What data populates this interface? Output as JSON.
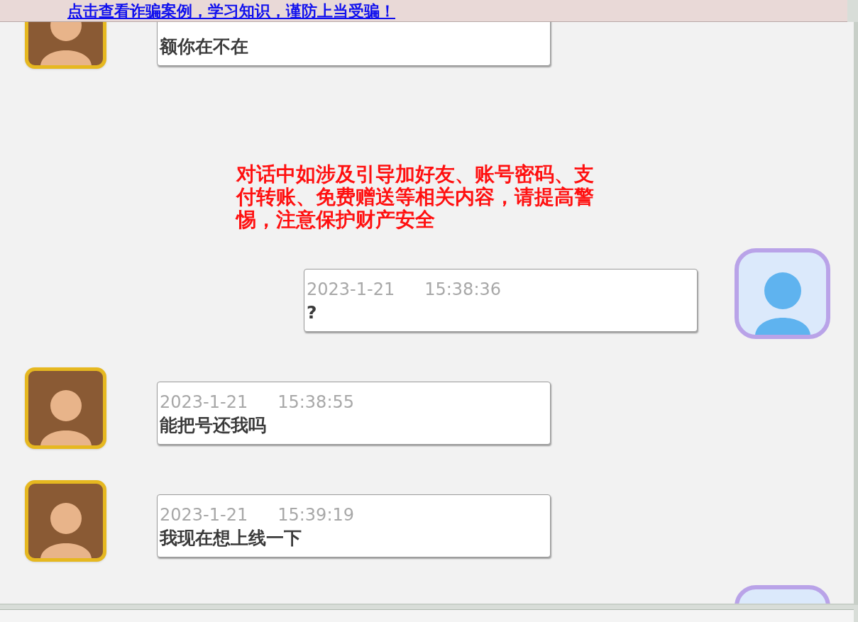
{
  "banner": {
    "link": "点击查看诈骗案例，学习知识，谨防上当受骗！"
  },
  "messages": [
    {
      "kind": "incoming",
      "text": "额你在不在"
    },
    {
      "kind": "notice",
      "text": "对话中如涉及引导加好友、账号密码、支付转账、免费赠送等相关内容，请提高警惕，注意保护财产安全"
    },
    {
      "kind": "outgoing",
      "date": "2023-1-21",
      "time": "15:38:36",
      "text": "?"
    },
    {
      "kind": "incoming",
      "date": "2023-1-21",
      "time": "15:38:55",
      "text": "能把号还我吗"
    },
    {
      "kind": "incoming",
      "date": "2023-1-21",
      "time": "15:39:19",
      "text": "我现在想上线一下"
    },
    {
      "kind": "outgoing_partial"
    }
  ]
}
